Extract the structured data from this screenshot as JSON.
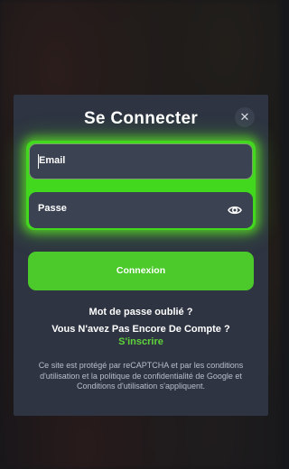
{
  "modal": {
    "title": "Se Connecter",
    "close_icon": "close-icon",
    "email_placeholder": "Email",
    "password_placeholder": "Passe",
    "password_toggle_icon": "eye-icon",
    "submit_label": "Connexion",
    "forgot_password": "Mot de passe oublié ?",
    "no_account": "Vous N'avez Pas Encore De Compte ?",
    "signup_link": "S'inscrire",
    "legal_text": "Ce site est protégé par reCAPTCHA et par les conditions d'utilisation et la politique de confidentialité de Google et Conditions d'utilisation s'appliquent."
  },
  "colors": {
    "accent": "#4cc92b",
    "modal_bg": "#2e3442",
    "field_bg": "#3b4252"
  }
}
